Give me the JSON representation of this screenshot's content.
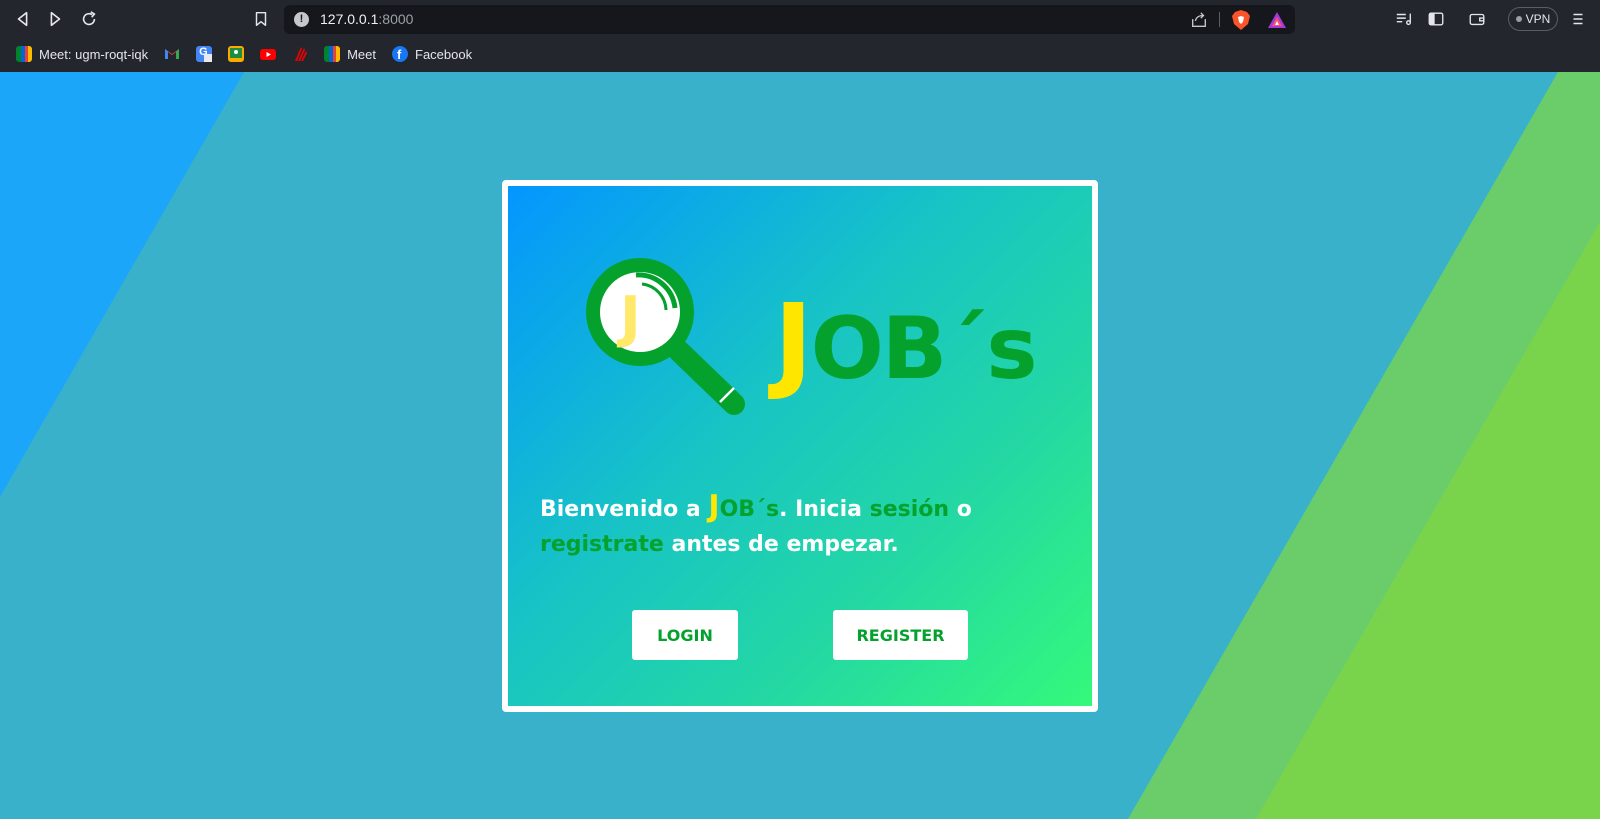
{
  "browser": {
    "url_host": "127.0.0.1",
    "url_port": ":8000",
    "vpn_label": "VPN",
    "bookmarks": [
      {
        "label": "Meet: ugm-roqt-iqk",
        "icon": "google-meet-icon"
      },
      {
        "label": "",
        "icon": "gmail-icon"
      },
      {
        "label": "",
        "icon": "google-translate-icon"
      },
      {
        "label": "",
        "icon": "google-classroom-icon"
      },
      {
        "label": "",
        "icon": "youtube-icon"
      },
      {
        "label": "",
        "icon": "santander-icon"
      },
      {
        "label": "Meet",
        "icon": "google-meet-icon"
      },
      {
        "label": "Facebook",
        "icon": "facebook-icon"
      }
    ]
  },
  "logo": {
    "mark_letter": "J",
    "brand_first": "J",
    "brand_rest": "OB´s"
  },
  "welcome": {
    "text_before": "Bienvenido a ",
    "brand_first": "J",
    "brand_rest": "OB´s",
    "text_middle": ". Inicia ",
    "login_link": "sesión",
    "text_or": " o ",
    "register_link": "registrate",
    "text_after": " antes de empezar."
  },
  "buttons": {
    "login": "LOGIN",
    "register": "REGISTER"
  },
  "colors": {
    "brand_green": "#04a12d",
    "brand_yellow": "#ffe600",
    "page_bg": "#39b1cb",
    "card_gradient_start": "#0396ff",
    "card_gradient_end": "#34f97b"
  }
}
